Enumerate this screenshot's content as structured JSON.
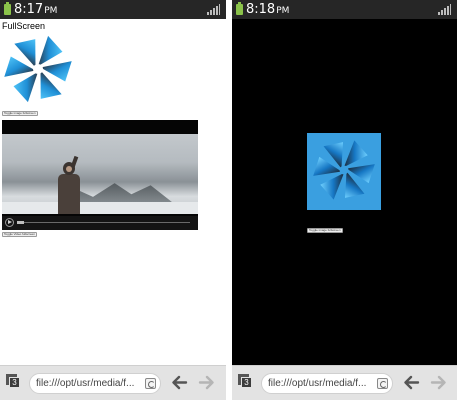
{
  "left_screen": {
    "status": {
      "time": "8:17",
      "ampm": "PM"
    },
    "page_title": "FullScreen",
    "image_toggle_label": "Toggle image fullscreen",
    "video_toggle_label": "Toggle Video fullscreen",
    "video_progress": 0.04,
    "toolbar": {
      "tab_count": "3",
      "url": "file:///opt/usr/media/f..."
    }
  },
  "right_screen": {
    "status": {
      "time": "8:18",
      "ampm": "PM"
    },
    "image_toggle_label": "Toggle image fullscreen",
    "toolbar": {
      "tab_count": "3",
      "url": "file:///opt/usr/media/f..."
    }
  },
  "icons": {
    "battery": "battery-icon",
    "signal": "signal-icon",
    "logo": "pinwheel-logo-icon",
    "tabs": "tabs-icon",
    "reload": "reload-icon",
    "back": "back-arrow-icon",
    "forward": "forward-arrow-icon",
    "play": "play-icon"
  },
  "colors": {
    "status_bar": "#262626",
    "battery": "#8bc34a",
    "logo_blue": "#29a8e8",
    "logo_dark": "#2b3a4a",
    "fullscreen_logo_bg": "#3a9fe0",
    "toolbar_bg": "#e3e3e3"
  }
}
